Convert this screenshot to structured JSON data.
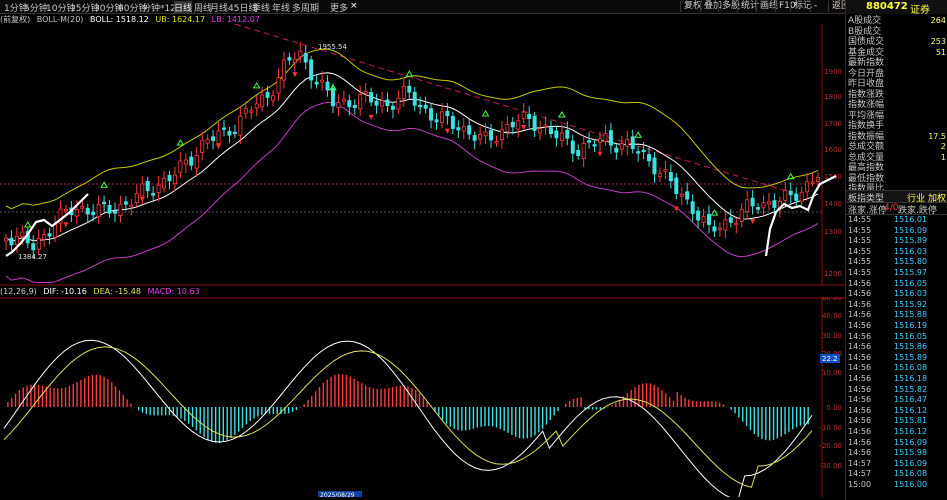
{
  "toolbar": {
    "periods": [
      "1分钟",
      "5分钟",
      "10分钟",
      "15分钟",
      "30分钟",
      "60分钟",
      "分钟*120",
      "日线",
      "周线",
      "月线",
      "45日线",
      "季线",
      "年线",
      "多周期",
      "更多"
    ],
    "active_period": "日线",
    "right_buttons": [
      "复权",
      "叠加",
      "多股",
      "统计",
      "画线",
      "F10",
      "标记",
      "-",
      "返回"
    ],
    "close_glyph": "×"
  },
  "price_legend": {
    "adjust": "(前复权)",
    "indicator": "BOLL-M(20)",
    "boll": "BOLL: 1518.12",
    "ub": "UB: 1624.17",
    "lb": "LB: 1412.07",
    "max_label": "1955.54",
    "min_label": "1384.27"
  },
  "macd_legend": {
    "params": "(12,26,9)",
    "dif": "DIF: -10.16",
    "dea": "DEA: -15.48",
    "macd": "MACD: 10.63"
  },
  "price_axis": [
    "1900",
    "1800",
    "1700",
    "1600",
    "1500",
    "1400",
    "1300",
    "1200"
  ],
  "macd_axis": [
    "60.00",
    "40.00",
    "30.00",
    "20.00",
    "10.00",
    "0.00",
    "-10.00",
    "-20.00",
    "-30.00"
  ],
  "macd_marker": "22.2",
  "date_marker": "2025/08/29",
  "right_panel": {
    "code": "880472",
    "name": "证券",
    "stats": [
      {
        "label": "A股成交",
        "value": "264"
      },
      {
        "label": "B股成交",
        "value": ""
      },
      {
        "label": "国债成交",
        "value": "253"
      },
      {
        "label": "基金成交",
        "value": "51"
      },
      {
        "label": "最新指数",
        "value": ""
      },
      {
        "label": "今日开盘",
        "value": ""
      },
      {
        "label": "昨日收盘",
        "value": ""
      },
      {
        "label": "指数涨跌",
        "value": ""
      },
      {
        "label": "指数涨幅",
        "value": ""
      },
      {
        "label": "平均涨幅",
        "value": ""
      },
      {
        "label": "指数换手",
        "value": ""
      },
      {
        "label": "指数振幅",
        "value": "17.5"
      },
      {
        "label": "总成交额",
        "value": "2"
      },
      {
        "label": "总成交量",
        "value": "1"
      },
      {
        "label": "最高指数",
        "value": ""
      },
      {
        "label": "最低指数",
        "value": ""
      },
      {
        "label": "指数量比",
        "value": ""
      }
    ],
    "tabs_row1": [
      "板指类型",
      "行业 加权"
    ],
    "tabs_row2": [
      "涨家.涨停",
      "4/0",
      "跌家.跌停"
    ],
    "ticks": [
      {
        "t": "14:55",
        "p": "1516.01"
      },
      {
        "t": "14:55",
        "p": "1516.09"
      },
      {
        "t": "14:55",
        "p": "1515.89"
      },
      {
        "t": "14:55",
        "p": "1516.03"
      },
      {
        "t": "14:55",
        "p": "1515.80"
      },
      {
        "t": "14:55",
        "p": "1515.97"
      },
      {
        "t": "14:56",
        "p": "1516.05"
      },
      {
        "t": "14:56",
        "p": "1516.03"
      },
      {
        "t": "14:56",
        "p": "1515.92"
      },
      {
        "t": "14:56",
        "p": "1515.88"
      },
      {
        "t": "14:56",
        "p": "1516.19"
      },
      {
        "t": "14:56",
        "p": "1516.05"
      },
      {
        "t": "14:56",
        "p": "1515.86"
      },
      {
        "t": "14:56",
        "p": "1515.89"
      },
      {
        "t": "14:56",
        "p": "1516.08"
      },
      {
        "t": "14:56",
        "p": "1516.18"
      },
      {
        "t": "14:56",
        "p": "1515.82"
      },
      {
        "t": "14:56",
        "p": "1516.47"
      },
      {
        "t": "14:56",
        "p": "1516.12"
      },
      {
        "t": "14:56",
        "p": "1515.81"
      },
      {
        "t": "14:56",
        "p": "1516.12"
      },
      {
        "t": "14:56",
        "p": "1516.09"
      },
      {
        "t": "14:56",
        "p": "1515.98"
      },
      {
        "t": "14:57",
        "p": "1516.09"
      },
      {
        "t": "14:57",
        "p": "1516.08"
      },
      {
        "t": "15:00",
        "p": "1516.00"
      }
    ]
  },
  "colors": {
    "up": "#ff3b3b",
    "down": "#40e0e0",
    "mid": "#ffffff",
    "ub": "#c8c800",
    "lb": "#c040c0",
    "dea": "#e0e060",
    "axis": "#8a1010"
  }
}
